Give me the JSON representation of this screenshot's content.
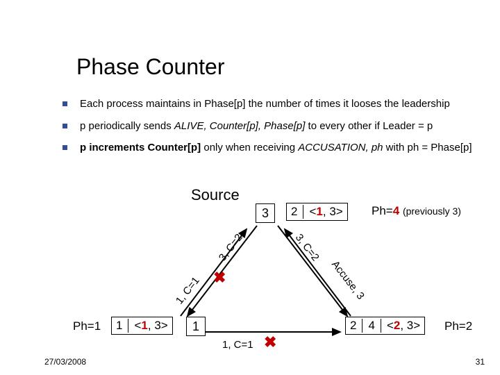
{
  "title": "Phase Counter",
  "bullets": {
    "b1": "Each process maintains in Phase[p] the number of times it looses the leadership",
    "b2_pre": "p periodically sends ",
    "b2_em": "ALIVE, Counter[p], Phase[p]",
    "b2_post": " to every other if Leader = p",
    "b3_pre": "p increments Counter[p]",
    "b3_mid": " only when receiving ",
    "b3_em": "ACCUSATION, ph",
    "b3_post": " with ph = Phase[p]"
  },
  "diagram": {
    "source": "Source",
    "node_left_ph": "Ph=1",
    "node_left_count": "1",
    "node_left_tuple_old": "<1, 3>",
    "node_left_tuple_bold": "1",
    "node_top_count": "3",
    "node_right_top_c": "2",
    "node_right_top_tuple_old": "<1, 3>",
    "node_right_top_tuple_bold": "1",
    "node_right_top_ph_label": "Ph=",
    "node_right_top_ph_new": "4",
    "node_right_top_ph_prev": "(previously 3)",
    "node_right_bottom_c": "2",
    "node_right_bottom_pair_a": "4",
    "node_right_bottom_tuple": "<2, 3>",
    "node_right_bottom_tuple_bold": "2",
    "node_right_bottom_ph": "Ph=2",
    "bottom_center": "1",
    "edge_tl": "3, C=2",
    "edge_tr": "3, C=2",
    "edge_l": "1, C=1",
    "edge_r": "Accuse, 3",
    "edge_b": "1, C=1"
  },
  "footer": {
    "date": "27/03/2008",
    "page": "31"
  }
}
